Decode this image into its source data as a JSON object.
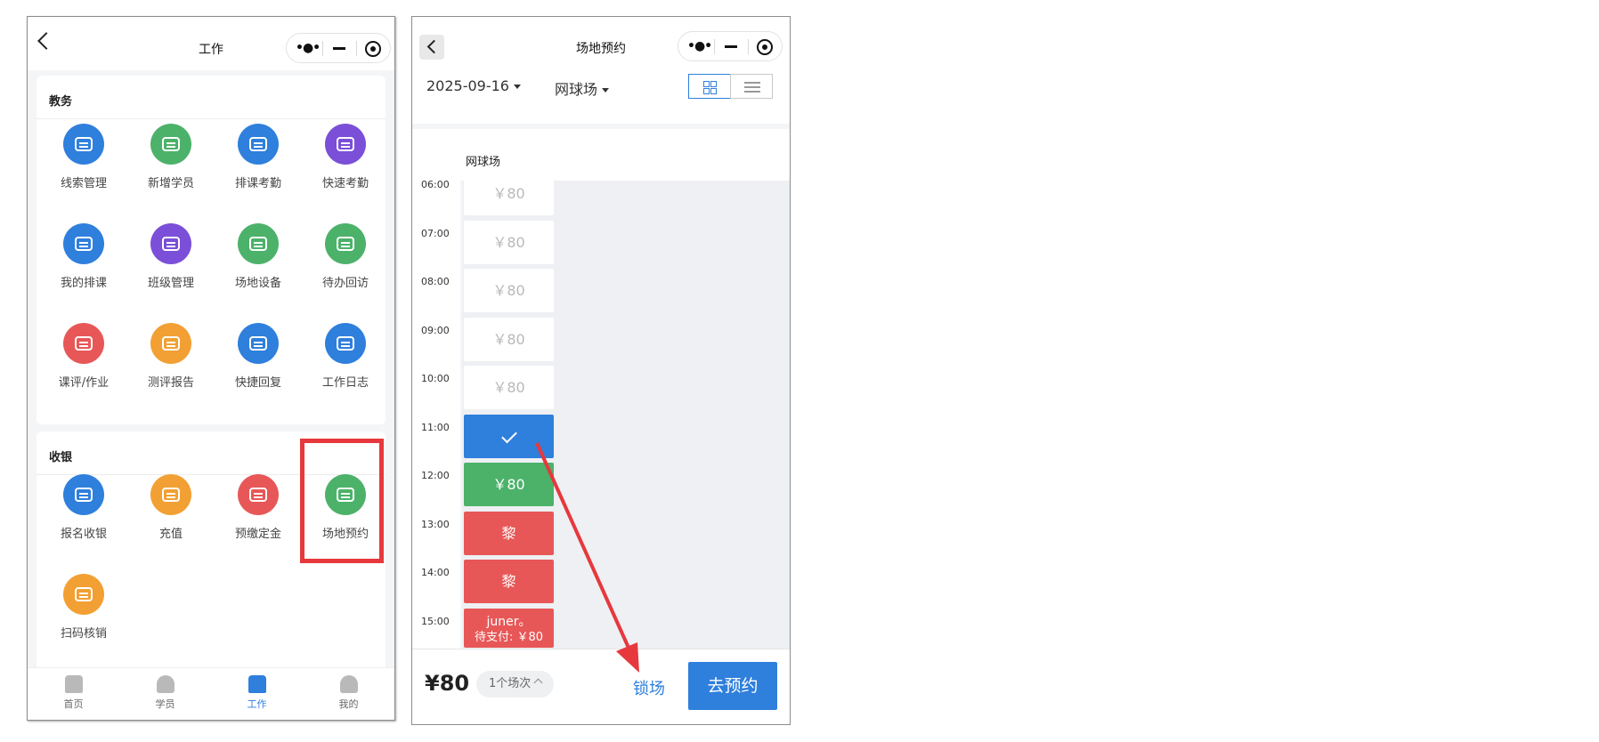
{
  "work_screen": {
    "title": "工作",
    "sections": [
      {
        "title": "教务",
        "items": [
          {
            "label": "线索管理",
            "icon": "link-icon",
            "color": "#2f7fdc"
          },
          {
            "label": "新增学员",
            "icon": "add-user-icon",
            "color": "#4cb26a"
          },
          {
            "label": "排课考勤",
            "icon": "schedule-check-icon",
            "color": "#2f7fdc"
          },
          {
            "label": "快速考勤",
            "icon": "quick-check-icon",
            "color": "#7b4fd8"
          },
          {
            "label": "我的排课",
            "icon": "my-schedule-icon",
            "color": "#2f7fdc"
          },
          {
            "label": "班级管理",
            "icon": "class-card-icon",
            "color": "#7b4fd8"
          },
          {
            "label": "场地设备",
            "icon": "equipment-icon",
            "color": "#4cb26a"
          },
          {
            "label": "待办回访",
            "icon": "phone-icon",
            "color": "#4cb26a"
          },
          {
            "label": "课评/作业",
            "icon": "list-doc-icon",
            "color": "#e85757"
          },
          {
            "label": "测评报告",
            "icon": "report-icon",
            "color": "#f2a033"
          },
          {
            "label": "快捷回复",
            "icon": "reply-icon",
            "color": "#2f7fdc"
          },
          {
            "label": "工作日志",
            "icon": "pen-icon",
            "color": "#2f7fdc"
          }
        ]
      },
      {
        "title": "收银",
        "items": [
          {
            "label": "报名收银",
            "icon": "register-cash-icon",
            "color": "#2f7fdc"
          },
          {
            "label": "充值",
            "icon": "yuan-wallet-icon",
            "color": "#f2a033"
          },
          {
            "label": "预缴定金",
            "icon": "yuan-shield-icon",
            "color": "#e85757"
          },
          {
            "label": "场地预约",
            "icon": "venue-booking-icon",
            "color": "#4cb26a"
          },
          {
            "label": "扫码核销",
            "icon": "scan-icon",
            "color": "#f2a033"
          }
        ]
      }
    ],
    "tabs": [
      {
        "label": "首页",
        "icon": "home-icon"
      },
      {
        "label": "学员",
        "icon": "student-icon"
      },
      {
        "label": "工作",
        "icon": "work-grid-icon",
        "active": true
      },
      {
        "label": "我的",
        "icon": "profile-icon"
      }
    ]
  },
  "booking_screen": {
    "title": "场地预约",
    "date": "2025-09-16",
    "venue": "网球场",
    "court_name": "网球场",
    "times": [
      "06:00",
      "07:00",
      "08:00",
      "09:00",
      "10:00",
      "11:00",
      "12:00",
      "13:00",
      "14:00",
      "15:00"
    ],
    "slots": [
      {
        "state": "free",
        "text": "￥80"
      },
      {
        "state": "free",
        "text": "￥80"
      },
      {
        "state": "free",
        "text": "￥80"
      },
      {
        "state": "free",
        "text": "￥80"
      },
      {
        "state": "free",
        "text": "￥80"
      },
      {
        "state": "selected",
        "text": ""
      },
      {
        "state": "price",
        "text": "￥80"
      },
      {
        "state": "booked",
        "text": "黎"
      },
      {
        "state": "booked",
        "text": "黎"
      },
      {
        "state": "booked",
        "text": "juner。",
        "subtext": "待支付: ￥80"
      }
    ],
    "footer": {
      "total": "¥80",
      "count": "1个场次",
      "lock_label": "锁场",
      "book_label": "去预约"
    }
  },
  "colors": {
    "primary": "#2f7fdc",
    "green": "#4cb26a",
    "red": "#e85757",
    "highlight": "#e6383d"
  }
}
